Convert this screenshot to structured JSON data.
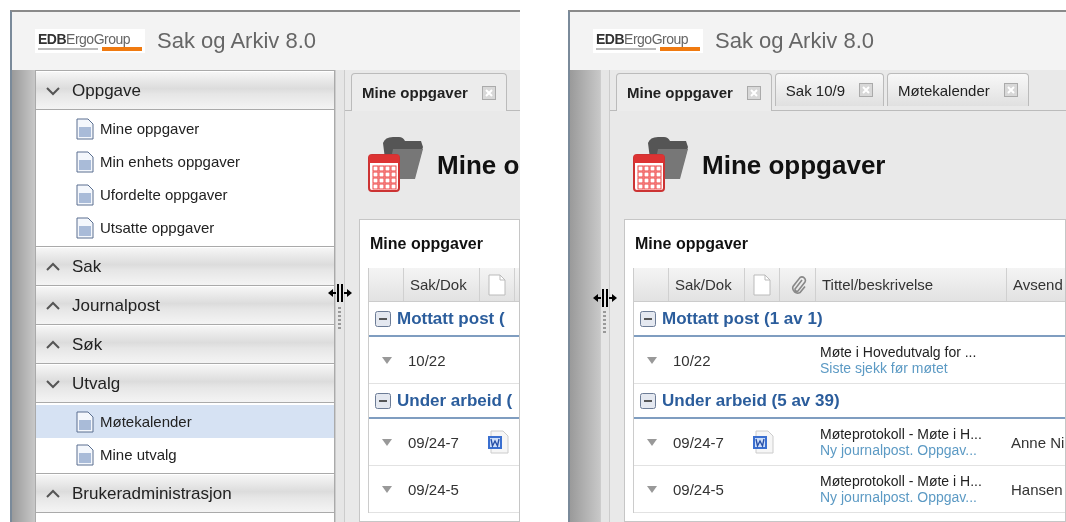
{
  "views": [
    {
      "logo": {
        "bold": "EDB",
        "light": "ErgoGroup"
      },
      "app_title": "Sak og Arkiv 8.0",
      "sidebar": {
        "collapsed": false,
        "sections": [
          {
            "label": "Oppgave",
            "expanded": true,
            "items": [
              {
                "label": "Mine oppgaver",
                "selected": false
              },
              {
                "label": "Min enhets oppgaver",
                "selected": false
              },
              {
                "label": "Ufordelte oppgaver",
                "selected": false
              },
              {
                "label": "Utsatte oppgaver",
                "selected": false
              }
            ]
          },
          {
            "label": "Sak",
            "expanded": false
          },
          {
            "label": "Journalpost",
            "expanded": false
          },
          {
            "label": "Søk",
            "expanded": false
          },
          {
            "label": "Utvalg",
            "expanded": true,
            "items": [
              {
                "label": "Møtekalender",
                "selected": true
              },
              {
                "label": "Mine utvalg",
                "selected": false
              }
            ]
          },
          {
            "label": "Brukeradministrasjon",
            "expanded": false
          }
        ]
      },
      "tabs": [
        {
          "label": "Mine oppgaver",
          "selected": true
        }
      ],
      "page_title": "Mine o",
      "panel_title": "Mine oppgaver",
      "columns": [
        {
          "kind": "blank"
        },
        {
          "kind": "case",
          "label": "Sak/Dok"
        },
        {
          "kind": "document"
        }
      ],
      "groups": [
        {
          "label": "Mottatt post (",
          "expanded": true,
          "rows": [
            {
              "case": "10/22",
              "has_document": false
            }
          ]
        },
        {
          "label": "Under arbeid (",
          "expanded": true,
          "rows": [
            {
              "case": "09/24-7",
              "has_document": true
            },
            {
              "case": "09/24-5",
              "has_document": false
            }
          ]
        }
      ]
    },
    {
      "logo": {
        "bold": "EDB",
        "light": "ErgoGroup"
      },
      "app_title": "Sak og Arkiv 8.0",
      "sidebar": {
        "collapsed": true
      },
      "tabs": [
        {
          "label": "Mine oppgaver",
          "selected": true
        },
        {
          "label": "Sak 10/9",
          "selected": false
        },
        {
          "label": "Møtekalender",
          "selected": false
        }
      ],
      "page_title": "Mine oppgaver",
      "panel_title": "Mine oppgaver",
      "columns": [
        {
          "kind": "blank"
        },
        {
          "kind": "case",
          "label": "Sak/Dok"
        },
        {
          "kind": "document"
        },
        {
          "kind": "attachment"
        },
        {
          "kind": "title",
          "label": "Tittel/beskrivelse"
        },
        {
          "kind": "sender",
          "label": "Avsend"
        }
      ],
      "groups": [
        {
          "label": "Mottatt post (1 av 1)",
          "expanded": true,
          "rows": [
            {
              "case": "10/22",
              "has_document": false,
              "title": "Møte i Hovedutvalg for ...",
              "description": "Siste sjekk før møtet"
            }
          ]
        },
        {
          "label": "Under arbeid (5 av 39)",
          "expanded": true,
          "rows": [
            {
              "case": "09/24-7",
              "has_document": true,
              "title": "Møteprotokoll - Møte i H...",
              "description": "Ny journalpost. Oppgav...",
              "sender": "Anne Ni"
            },
            {
              "case": "09/24-5",
              "has_document": false,
              "title": "Møteprotokoll - Møte i H...",
              "description": "Ny journalpost. Oppgav...",
              "sender": "Hansen"
            }
          ]
        }
      ]
    }
  ]
}
